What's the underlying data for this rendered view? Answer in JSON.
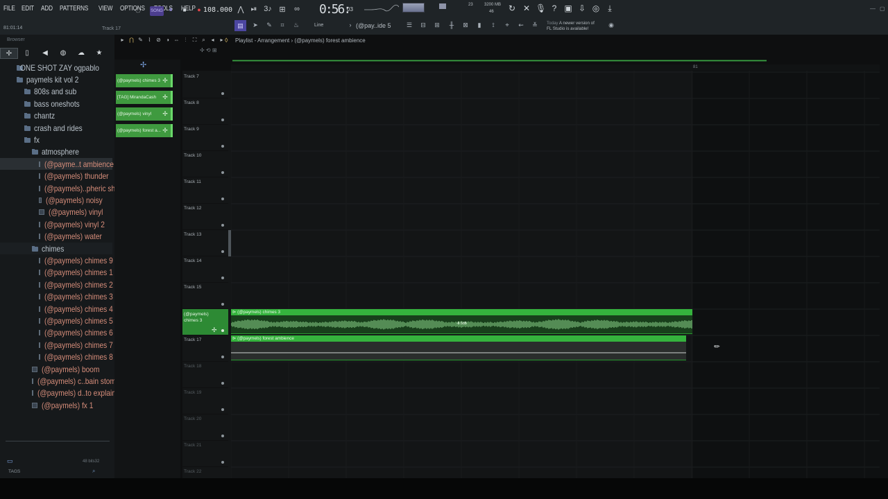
{
  "menu": [
    "FILE",
    "EDIT",
    "ADD",
    "PATTERNS",
    "VIEW",
    "OPTIONS",
    "TOOLS",
    "HELP"
  ],
  "hint": {
    "position": "81:01:14",
    "track": "Track 17"
  },
  "transport": {
    "mode": "SONG",
    "tempo": "108.000",
    "time": "0:56:",
    "time_ms": "03"
  },
  "monitor": {
    "cpu": "23",
    "mem": "3200 MB",
    "mem2": "46"
  },
  "toolbar2": {
    "line_label": "Line",
    "pattern": "(@pay..ide 5"
  },
  "news": {
    "today": "Today",
    "line1": "A newer version of",
    "line2": "FL Studio is available!"
  },
  "browser": {
    "title": "Browser",
    "tree": [
      {
        "label": "ONE SHOT ZAY ogpablo",
        "depth": 1,
        "kind": "folder"
      },
      {
        "label": "paymels kit vol 2",
        "depth": 1,
        "kind": "folder"
      },
      {
        "label": "808s and sub",
        "depth": 2,
        "kind": "folder"
      },
      {
        "label": "bass oneshots",
        "depth": 2,
        "kind": "folder"
      },
      {
        "label": "chantz",
        "depth": 2,
        "kind": "folder"
      },
      {
        "label": "crash and rides",
        "depth": 2,
        "kind": "folder"
      },
      {
        "label": "fx",
        "depth": 2,
        "kind": "folder"
      },
      {
        "label": "atmosphere",
        "depth": 3,
        "kind": "folder"
      },
      {
        "label": "(@payme..t ambience",
        "depth": 4,
        "kind": "audio",
        "selected": true
      },
      {
        "label": "(@paymels)  thunder",
        "depth": 4,
        "kind": "audio"
      },
      {
        "label": "(@paymels)..pheric shi",
        "depth": 4,
        "kind": "audio"
      },
      {
        "label": "(@paymels) noisy",
        "depth": 4,
        "kind": "audio"
      },
      {
        "label": "(@paymels) vinyl",
        "depth": 4,
        "kind": "audio"
      },
      {
        "label": "(@paymels) vinyl 2",
        "depth": 4,
        "kind": "audio"
      },
      {
        "label": "(@paymels) water",
        "depth": 4,
        "kind": "audio"
      },
      {
        "label": "chimes",
        "depth": 3,
        "kind": "folder",
        "shaded": true
      },
      {
        "label": "(@paymels)  chimes 9",
        "depth": 4,
        "kind": "audio"
      },
      {
        "label": "(@paymels) chimes 1",
        "depth": 4,
        "kind": "audio"
      },
      {
        "label": "(@paymels) chimes 2",
        "depth": 4,
        "kind": "audio"
      },
      {
        "label": "(@paymels) chimes 3",
        "depth": 4,
        "kind": "audio"
      },
      {
        "label": "(@paymels) chimes 4",
        "depth": 4,
        "kind": "audio"
      },
      {
        "label": "(@paymels) chimes 5",
        "depth": 4,
        "kind": "audio"
      },
      {
        "label": "(@paymels) chimes 6",
        "depth": 4,
        "kind": "audio"
      },
      {
        "label": "(@paymels) chimes 7",
        "depth": 4,
        "kind": "audio"
      },
      {
        "label": "(@paymels) chimes 8",
        "depth": 4,
        "kind": "audio"
      },
      {
        "label": "(@paymels) boom",
        "depth": 3,
        "kind": "audio"
      },
      {
        "label": "(@paymels) c..bain stomp",
        "depth": 3,
        "kind": "audio"
      },
      {
        "label": "(@paymels) d..to explain",
        "depth": 3,
        "kind": "audio"
      },
      {
        "label": "(@paymels) fx 1",
        "depth": 3,
        "kind": "audio"
      }
    ],
    "tags_label": "TAGS",
    "bits": "48 bits32"
  },
  "playlist": {
    "title": "Playlist - Arrangement › (@paymels)  forest ambience",
    "bar_marker": "81",
    "picker": [
      "(@paymels) chimes 3",
      "[TAG] MirandaCash",
      "(@paymels) vinyl",
      "(@paymels) forest a..."
    ],
    "tracks": [
      {
        "name": "Track 7"
      },
      {
        "name": "Track 8"
      },
      {
        "name": "Track 9"
      },
      {
        "name": "Track 10"
      },
      {
        "name": "Track 11"
      },
      {
        "name": "Track 12"
      },
      {
        "name": "Track 13"
      },
      {
        "name": "Track 14"
      },
      {
        "name": "Track 15"
      },
      {
        "name": "(@paymels) chimes 3",
        "highlight": true
      },
      {
        "name": "Track 17"
      },
      {
        "name": "Track 18",
        "dim": true
      },
      {
        "name": "Track 19",
        "dim": true
      },
      {
        "name": "Track 20",
        "dim": true
      },
      {
        "name": "Track 21",
        "dim": true
      },
      {
        "name": "Track 22",
        "dim": true
      }
    ],
    "clips": [
      {
        "label": "(@paymels) chimes 3",
        "gain": "-8.5dB"
      },
      {
        "label": "(@paymels)  forest ambience"
      }
    ]
  }
}
